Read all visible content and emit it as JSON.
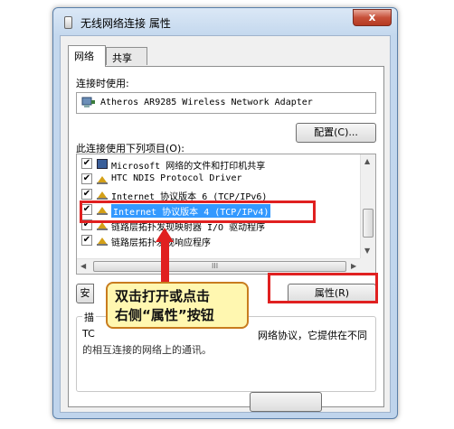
{
  "window": {
    "title": "无线网络连接 属性",
    "close_glyph": "x"
  },
  "tabs": [
    {
      "label": "网络"
    },
    {
      "label": "共享"
    }
  ],
  "connect_using": {
    "label": "连接时使用:",
    "adapter": "Atheros AR9285 Wireless Network Adapter",
    "configure_button": "配置(C)..."
  },
  "items_section": {
    "label": "此连接使用下列项目(O):",
    "items": [
      {
        "label": "Microsoft 网络的文件和打印机共享",
        "checked": true,
        "icon": "network-share-icon",
        "check_glyph": "✔"
      },
      {
        "label": "HTC NDIS Protocol Driver",
        "checked": true,
        "icon": "protocol-icon",
        "check_glyph": "✔"
      },
      {
        "label": "Internet 协议版本 6 (TCP/IPv6)",
        "checked": true,
        "icon": "protocol-icon",
        "check_glyph": "✔"
      },
      {
        "label": "Internet 协议版本 4 (TCP/IPv4)",
        "checked": true,
        "selected": true,
        "icon": "protocol-icon",
        "check_glyph": "✔"
      },
      {
        "label": "链路层拓扑发现映射器 I/O 驱动程序",
        "checked": true,
        "icon": "protocol-icon",
        "check_glyph": "✔"
      },
      {
        "label": "链路层拓扑发现响应程序",
        "checked": true,
        "icon": "protocol-icon",
        "check_glyph": "✔"
      }
    ]
  },
  "buttons": {
    "install_partial": "安",
    "properties": "属性(R)"
  },
  "description": {
    "label_partial": "描",
    "text_line1_prefix": "TC",
    "text_line1_suffix": "网络协议，它提供在不同",
    "text_line2": "的相互连接的网络上的通讯。"
  },
  "callout": {
    "line1": "双击打开或点击",
    "line2": "右侧“属性”按钮"
  },
  "scrollbar": {
    "up": "▲",
    "down": "▼",
    "left": "◀",
    "right": "▶",
    "grip": "III"
  },
  "colors": {
    "annotation_red": "#e02020",
    "selection_blue": "#3399ff",
    "callout_fill": "#fff7b0"
  }
}
